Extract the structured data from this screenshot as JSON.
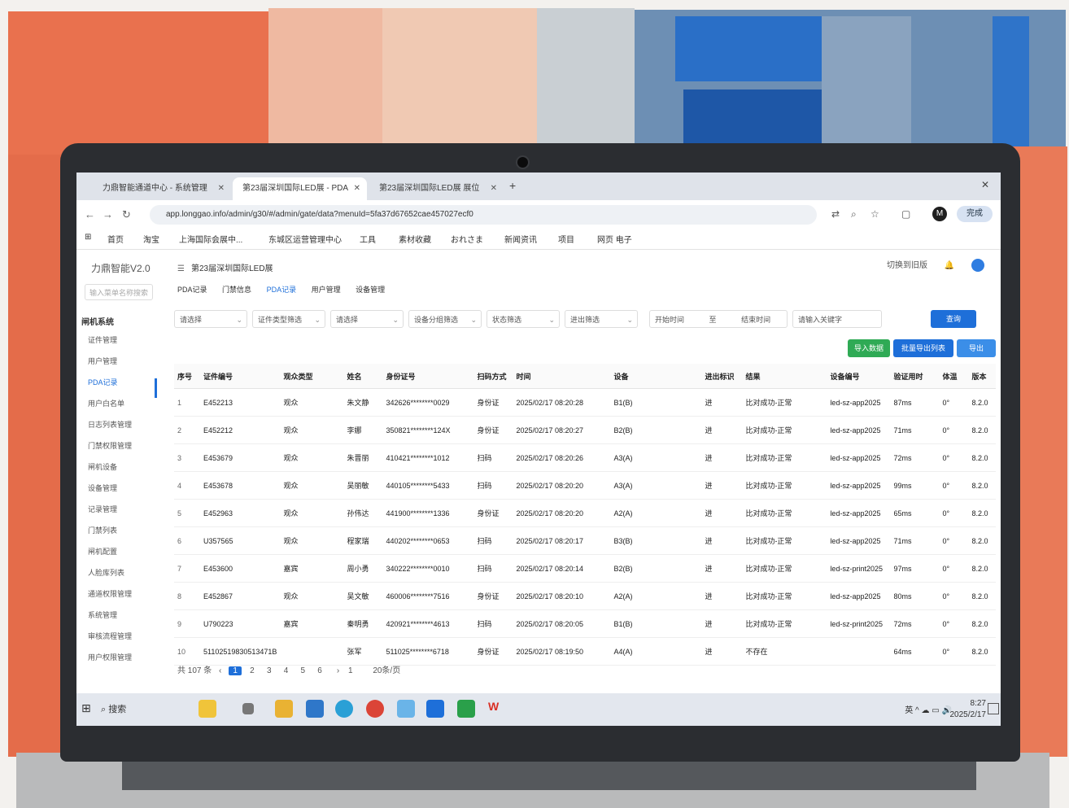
{
  "browser": {
    "tabs": [
      {
        "label": "力鼎智能通道中心 - 系统管理"
      },
      {
        "label": "第23届深圳国际LED展 - PDA",
        "active": true
      },
      {
        "label": "第23届深圳国际LED展 展位"
      }
    ],
    "new_tab": "+",
    "window_controls": "✕",
    "address": "app.longgao.info/admin/g30/#/admin/gate/data?menuId=5fa37d67652cae457027ecf0",
    "profile_initial": "M",
    "finish_button": "完成",
    "bookmarks": [
      "首页",
      "淘宝",
      "上海国际会展中...",
      "东城区运营管理中心",
      "工具",
      "素材收藏",
      "おれさま",
      "新闻资讯",
      "项目",
      "网页 电子"
    ]
  },
  "sidebar": {
    "logo": "力鼎智能V2.0",
    "search_placeholder": "输入菜单名称搜索",
    "group": "闸机系统",
    "items": [
      {
        "label": "证件管理"
      },
      {
        "label": "用户管理"
      },
      {
        "label": "PDA记录",
        "active": true
      },
      {
        "label": "用户白名单"
      },
      {
        "label": "日志列表管理"
      },
      {
        "label": "门禁权限管理"
      },
      {
        "label": "闸机设备"
      },
      {
        "label": "设备管理"
      },
      {
        "label": "记录管理"
      },
      {
        "label": "门禁列表"
      },
      {
        "label": "闸机配置"
      },
      {
        "label": "人脸库列表"
      },
      {
        "label": "通道权限管理"
      },
      {
        "label": "系统管理"
      },
      {
        "label": "审核流程管理"
      },
      {
        "label": "用户权限管理"
      }
    ]
  },
  "header": {
    "breadcrumb": "第23届深圳国际LED展",
    "switch_label": "切换到旧版",
    "bell": "🔔"
  },
  "subtabs": [
    "PDA记录",
    "门禁信息",
    "PDA记录",
    "用户管理",
    "设备管理"
  ],
  "filters": [
    {
      "label": "请选择"
    },
    {
      "label": "证件类型筛选"
    },
    {
      "label": "请选择"
    },
    {
      "label": "设备分组筛选"
    },
    {
      "label": "状态筛选"
    },
    {
      "label": "进出筛选"
    }
  ],
  "date_range": {
    "start": "开始时间",
    "sep": "至",
    "end": "结束时间"
  },
  "keyword_placeholder": "请输入关键字",
  "search_button": "查询",
  "actions": {
    "import": "导入数据",
    "batch": "批量导出列表",
    "export": "导出"
  },
  "table": {
    "columns": [
      "序号",
      "证件编号",
      "观众类型",
      "姓名",
      "身份证号",
      "扫码方式",
      "时间",
      "设备",
      "进出标识",
      "结果",
      "设备编号",
      "验证用时",
      "体温",
      "版本"
    ],
    "rows": [
      [
        "1",
        "E452213",
        "观众",
        "朱文静",
        "342626********0029",
        "身份证",
        "2025/02/17 08:20:28",
        "B1(B)",
        "进",
        "比对成功-正常",
        "led-sz-app2025",
        "87ms",
        "0°",
        "8.2.0"
      ],
      [
        "2",
        "E452212",
        "观众",
        "李娜",
        "350821********124X",
        "身份证",
        "2025/02/17 08:20:27",
        "B2(B)",
        "进",
        "比对成功-正常",
        "led-sz-app2025",
        "71ms",
        "0°",
        "8.2.0"
      ],
      [
        "3",
        "E453679",
        "观众",
        "朱晋丽",
        "410421********1012",
        "扫码",
        "2025/02/17 08:20:26",
        "A3(A)",
        "进",
        "比对成功-正常",
        "led-sz-app2025",
        "72ms",
        "0°",
        "8.2.0"
      ],
      [
        "4",
        "E453678",
        "观众",
        "吴丽敏",
        "440105********5433",
        "扫码",
        "2025/02/17 08:20:20",
        "A3(A)",
        "进",
        "比对成功-正常",
        "led-sz-app2025",
        "99ms",
        "0°",
        "8.2.0"
      ],
      [
        "5",
        "E452963",
        "观众",
        "孙伟达",
        "441900********1336",
        "身份证",
        "2025/02/17 08:20:20",
        "A2(A)",
        "进",
        "比对成功-正常",
        "led-sz-app2025",
        "65ms",
        "0°",
        "8.2.0"
      ],
      [
        "6",
        "U357565",
        "观众",
        "程家瑞",
        "440202********0653",
        "扫码",
        "2025/02/17 08:20:17",
        "B3(B)",
        "进",
        "比对成功-正常",
        "led-sz-app2025",
        "71ms",
        "0°",
        "8.2.0"
      ],
      [
        "7",
        "E453600",
        "嘉宾",
        "周小勇",
        "340222********0010",
        "扫码",
        "2025/02/17 08:20:14",
        "B2(B)",
        "进",
        "比对成功-正常",
        "led-sz-print2025",
        "97ms",
        "0°",
        "8.2.0"
      ],
      [
        "8",
        "E452867",
        "观众",
        "吴文敏",
        "460006********7516",
        "身份证",
        "2025/02/17 08:20:10",
        "A2(A)",
        "进",
        "比对成功-正常",
        "led-sz-app2025",
        "80ms",
        "0°",
        "8.2.0"
      ],
      [
        "9",
        "U790223",
        "嘉宾",
        "秦明勇",
        "420921********4613",
        "扫码",
        "2025/02/17 08:20:05",
        "B1(B)",
        "进",
        "比对成功-正常",
        "led-sz-print2025",
        "72ms",
        "0°",
        "8.2.0"
      ],
      [
        "10",
        "51102519830513471B",
        "",
        "张军",
        "511025********6718",
        "身份证",
        "2025/02/17 08:19:50",
        "A4(A)",
        "进",
        "不存在",
        "",
        "64ms",
        "0°",
        "8.2.0"
      ]
    ]
  },
  "pagination": {
    "total": "共 107 条",
    "pages": [
      "1",
      "2",
      "3",
      "4",
      "5",
      "6"
    ],
    "current": "1",
    "goto": "1",
    "page_size": "20条/页"
  },
  "taskbar": {
    "search": "搜索",
    "tray": "英 ^ ☁ ▭ 🔊 ",
    "time": "8:27",
    "date": "2025/2/17"
  }
}
